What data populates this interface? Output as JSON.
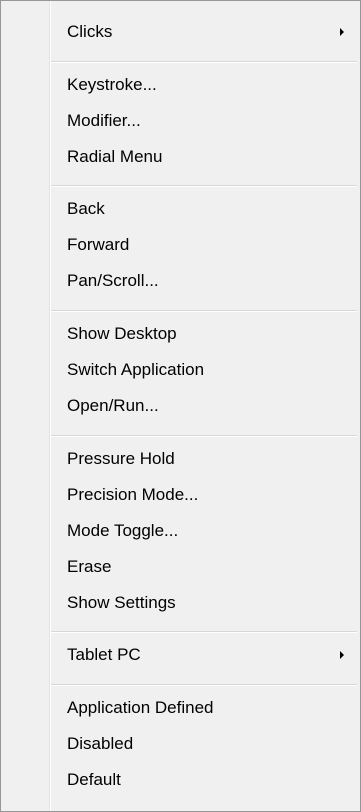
{
  "menu": {
    "clicks": "Clicks",
    "keystroke": "Keystroke...",
    "modifier": "Modifier...",
    "radial_menu": "Radial Menu",
    "back": "Back",
    "forward": "Forward",
    "pan_scroll": "Pan/Scroll...",
    "show_desktop": "Show Desktop",
    "switch_application": "Switch Application",
    "open_run": "Open/Run...",
    "pressure_hold": "Pressure Hold",
    "precision_mode": "Precision Mode...",
    "mode_toggle": "Mode Toggle...",
    "erase": "Erase",
    "show_settings": "Show Settings",
    "tablet_pc": "Tablet PC",
    "application_defined": "Application Defined",
    "disabled": "Disabled",
    "default": "Default"
  },
  "icons": {
    "submenu": "chevron-right-icon"
  }
}
